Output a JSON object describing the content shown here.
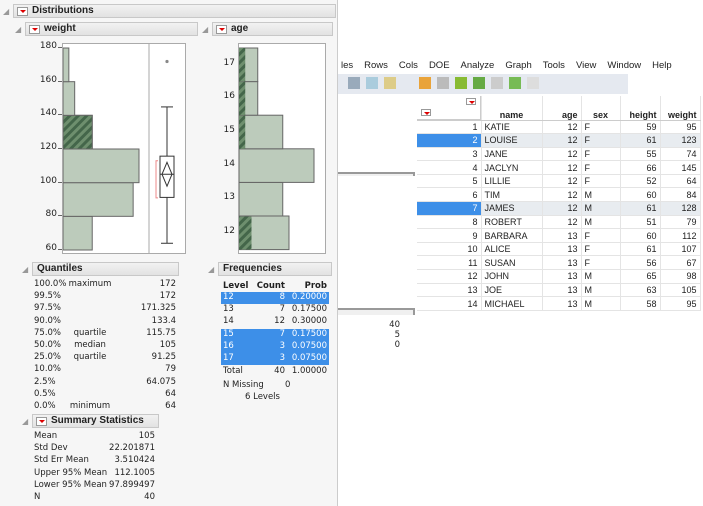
{
  "distributions": {
    "title": "Distributions"
  },
  "weight": {
    "title": "weight",
    "axis_ticks": [
      "180",
      "160",
      "140",
      "120",
      "100",
      "80",
      "60"
    ],
    "ylim": [
      60,
      180
    ],
    "bins": [
      {
        "lo": 60,
        "hi": 80,
        "count": 5
      },
      {
        "lo": 80,
        "hi": 100,
        "count": 12
      },
      {
        "lo": 100,
        "hi": 120,
        "count": 13
      },
      {
        "lo": 120,
        "hi": 140,
        "count": 5,
        "selected": 5
      },
      {
        "lo": 140,
        "hi": 160,
        "count": 2
      },
      {
        "lo": 160,
        "hi": 180,
        "count": 1
      }
    ],
    "box": {
      "min": 64,
      "q1": 91.25,
      "median": 105,
      "q3": 115.75,
      "whisker_hi": 145,
      "outlier": 172,
      "mean": 105,
      "ci_lo": 97.899497,
      "ci_hi": 112.1005,
      "shortest_half": [
        91,
        113
      ]
    }
  },
  "age": {
    "title": "age",
    "axis_ticks": [
      "17",
      "16",
      "15",
      "14",
      "13",
      "12"
    ],
    "bars": [
      {
        "level": 12,
        "count": 8,
        "selected": 2
      },
      {
        "level": 13,
        "count": 7,
        "selected": 0
      },
      {
        "level": 14,
        "count": 12,
        "selected": 0
      },
      {
        "level": 15,
        "count": 7,
        "selected": 1
      },
      {
        "level": 16,
        "count": 3,
        "selected": 1
      },
      {
        "level": 17,
        "count": 3,
        "selected": 1
      }
    ]
  },
  "quantiles": {
    "title": "Quantiles",
    "rows": [
      {
        "p": "100.0%",
        "label": "maximum",
        "v": "172"
      },
      {
        "p": "99.5%",
        "label": "",
        "v": "172"
      },
      {
        "p": "97.5%",
        "label": "",
        "v": "171.325"
      },
      {
        "p": "90.0%",
        "label": "",
        "v": "133.4"
      },
      {
        "p": "75.0%",
        "label": "quartile",
        "v": "115.75"
      },
      {
        "p": "50.0%",
        "label": "median",
        "v": "105"
      },
      {
        "p": "25.0%",
        "label": "quartile",
        "v": "91.25"
      },
      {
        "p": "10.0%",
        "label": "",
        "v": "79"
      },
      {
        "p": "2.5%",
        "label": "",
        "v": "64.075"
      },
      {
        "p": "0.5%",
        "label": "",
        "v": "64"
      },
      {
        "p": "0.0%",
        "label": "minimum",
        "v": "64"
      }
    ]
  },
  "summary": {
    "title": "Summary Statistics",
    "rows": [
      {
        "k": "Mean",
        "v": "105"
      },
      {
        "k": "Std Dev",
        "v": "22.201871"
      },
      {
        "k": "Std Err Mean",
        "v": "3.510424"
      },
      {
        "k": "Upper 95% Mean",
        "v": "112.1005"
      },
      {
        "k": "Lower 95% Mean",
        "v": "97.899497"
      },
      {
        "k": "N",
        "v": "40"
      }
    ]
  },
  "frequencies": {
    "title": "Frequencies",
    "headers": [
      "Level",
      "Count",
      "Prob"
    ],
    "rows": [
      {
        "level": "12",
        "count": "8",
        "prob": "0.20000",
        "selected": true
      },
      {
        "level": "13",
        "count": "7",
        "prob": "0.17500",
        "selected": false
      },
      {
        "level": "14",
        "count": "12",
        "prob": "0.30000",
        "selected": false
      },
      {
        "level": "15",
        "count": "7",
        "prob": "0.17500",
        "selected": true
      },
      {
        "level": "16",
        "count": "3",
        "prob": "0.07500",
        "selected": true
      },
      {
        "level": "17",
        "count": "3",
        "prob": "0.07500",
        "selected": true
      }
    ],
    "total": {
      "label": "Total",
      "count": "40",
      "prob": "1.00000"
    },
    "missing_label": "N Missing",
    "missing": "0",
    "levels": "6  Levels"
  },
  "datatable": {
    "menu": [
      "les",
      "Rows",
      "Cols",
      "DOE",
      "Analyze",
      "Graph",
      "Tools",
      "View",
      "Window",
      "Help"
    ],
    "side_counts": [
      "40",
      "5",
      "0"
    ],
    "columns": [
      "name",
      "age",
      "sex",
      "height",
      "weight"
    ],
    "rows": [
      {
        "n": "1",
        "name": "KATIE",
        "age": "12",
        "sex": "F",
        "height": "59",
        "weight": "95",
        "sel": false
      },
      {
        "n": "2",
        "name": "LOUISE",
        "age": "12",
        "sex": "F",
        "height": "61",
        "weight": "123",
        "sel": true
      },
      {
        "n": "3",
        "name": "JANE",
        "age": "12",
        "sex": "F",
        "height": "55",
        "weight": "74",
        "sel": false
      },
      {
        "n": "4",
        "name": "JACLYN",
        "age": "12",
        "sex": "F",
        "height": "66",
        "weight": "145",
        "sel": false
      },
      {
        "n": "5",
        "name": "LILLIE",
        "age": "12",
        "sex": "F",
        "height": "52",
        "weight": "64",
        "sel": false
      },
      {
        "n": "6",
        "name": "TIM",
        "age": "12",
        "sex": "M",
        "height": "60",
        "weight": "84",
        "sel": false
      },
      {
        "n": "7",
        "name": "JAMES",
        "age": "12",
        "sex": "M",
        "height": "61",
        "weight": "128",
        "sel": true
      },
      {
        "n": "8",
        "name": "ROBERT",
        "age": "12",
        "sex": "M",
        "height": "51",
        "weight": "79",
        "sel": false
      },
      {
        "n": "9",
        "name": "BARBARA",
        "age": "13",
        "sex": "F",
        "height": "60",
        "weight": "112",
        "sel": false
      },
      {
        "n": "10",
        "name": "ALICE",
        "age": "13",
        "sex": "F",
        "height": "61",
        "weight": "107",
        "sel": false
      },
      {
        "n": "11",
        "name": "SUSAN",
        "age": "13",
        "sex": "F",
        "height": "56",
        "weight": "67",
        "sel": false
      },
      {
        "n": "12",
        "name": "JOHN",
        "age": "13",
        "sex": "M",
        "height": "65",
        "weight": "98",
        "sel": false
      },
      {
        "n": "13",
        "name": "JOE",
        "age": "13",
        "sex": "M",
        "height": "63",
        "weight": "105",
        "sel": false
      },
      {
        "n": "14",
        "name": "MICHAEL",
        "age": "13",
        "sex": "M",
        "height": "58",
        "weight": "95",
        "sel": false
      }
    ]
  },
  "colors": {
    "bar": "#bccbbb",
    "bar_selected": "#4f7a4f",
    "selection": "#3d8fe8",
    "row_selected": "#e8ecf0"
  }
}
